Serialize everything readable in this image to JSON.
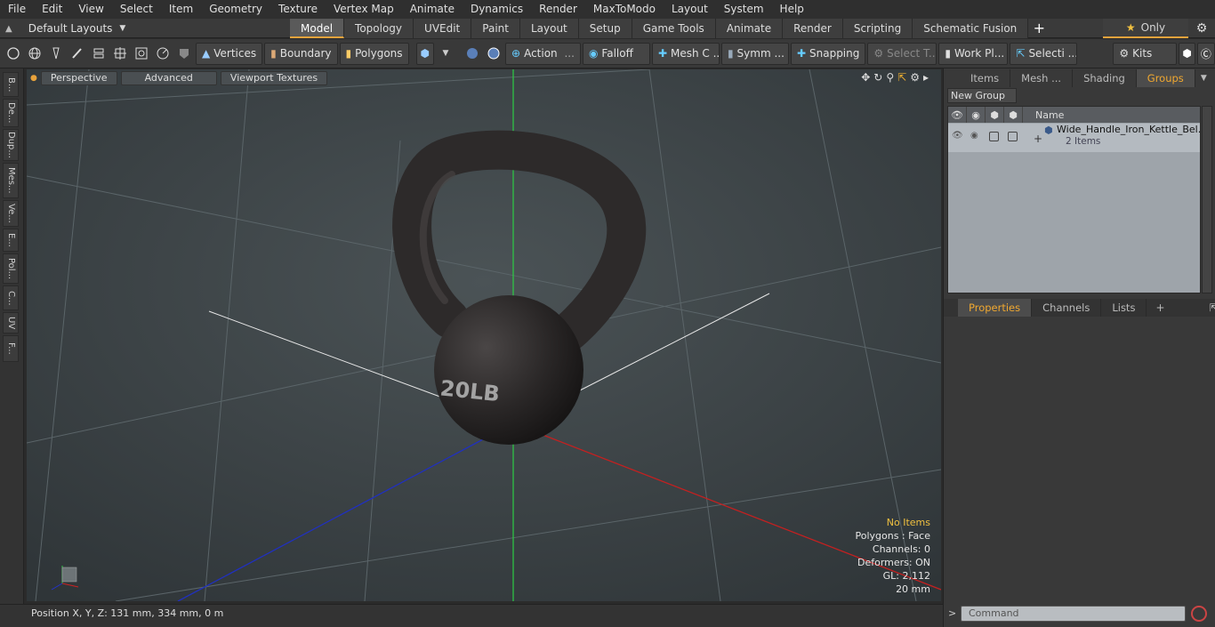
{
  "menu": [
    "File",
    "Edit",
    "View",
    "Select",
    "Item",
    "Geometry",
    "Texture",
    "Vertex Map",
    "Animate",
    "Dynamics",
    "Render",
    "MaxToModo",
    "Layout",
    "System",
    "Help"
  ],
  "layout_selector": "Default Layouts",
  "tabs": [
    "Model",
    "Topology",
    "UVEdit",
    "Paint",
    "Layout",
    "Setup",
    "Game Tools",
    "Animate",
    "Render",
    "Scripting",
    "Schematic Fusion"
  ],
  "active_tab": "Model",
  "only_label": "Only",
  "toolbar": {
    "vertices": "Vertices",
    "boundary": "Boundary",
    "polygons": "Polygons",
    "action": "Action",
    "falloff": "Falloff",
    "mesh": "Mesh C ...",
    "symm": "Symm ...",
    "snapping": "Snapping",
    "select_t": "Select T...",
    "workplane": "Work Pl...",
    "selecti": "Selecti ...",
    "kits": "Kits"
  },
  "left_tabs": [
    "B...",
    "De...",
    "Dup...",
    "Mes...",
    "Ve...",
    "E...",
    "Pol...",
    "C...",
    "UV",
    "F..."
  ],
  "viewport": {
    "perspective": "Perspective",
    "advanced": "Advanced",
    "textures": "Viewport Textures",
    "kettle_label": "20LB",
    "stats": {
      "no_items": "No Items",
      "polygons": "Polygons : Face",
      "channels": "Channels: 0",
      "deformers": "Deformers: ON",
      "gl": "GL: 2,112",
      "scale": "20 mm"
    }
  },
  "status": "Position X, Y, Z:   131 mm, 334 mm, 0 m",
  "right_panel": {
    "tabs": [
      "Items",
      "Mesh ...",
      "Shading",
      "Groups"
    ],
    "active_tab": "Groups",
    "new_group": "New Group",
    "name_header": "Name",
    "group_name": "Wide_Handle_Iron_Kettle_Bel...",
    "group_count": "2 Items",
    "props_tabs": [
      "Properties",
      "Channels",
      "Lists"
    ]
  },
  "command_placeholder": "Command",
  "colors": {
    "accent": "#e8a33c",
    "viewport_bg": "#3e4548",
    "x_axis": "#cc2222",
    "y_axis": "#22cc44",
    "z_axis": "#2233cc"
  }
}
